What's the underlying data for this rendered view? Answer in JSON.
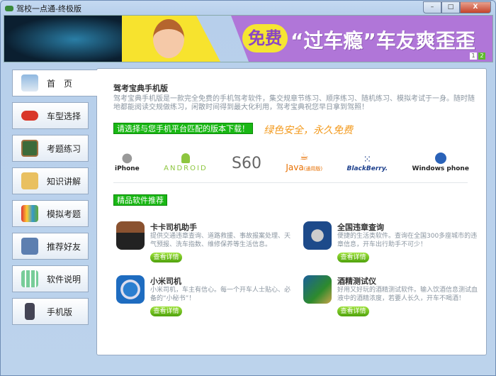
{
  "window": {
    "title": "驾校一点通-终极版",
    "minimize": "–",
    "maximize": "□",
    "close": "X"
  },
  "banner": {
    "badge": "免费",
    "headline": "“过车瘾”车友爽歪歪",
    "pages": [
      "1",
      "2"
    ]
  },
  "sidebar": {
    "items": [
      {
        "label": "首　页"
      },
      {
        "label": "车型选择"
      },
      {
        "label": "考题练习"
      },
      {
        "label": "知识讲解"
      },
      {
        "label": "模拟考题"
      },
      {
        "label": "推荐好友"
      },
      {
        "label": "软件说明"
      },
      {
        "label": "手机版"
      }
    ]
  },
  "main": {
    "title": "驾考宝典手机版",
    "description": "驾考宝典手机版是一款完全免费的手机驾考软件，集交规章节练习、顺序练习、随机练习、模拟考试于一身。随时随地都能阅读交规做练习，闲散时间得到最大化利用，驾考宝典祝您早日拿到驾照！",
    "download_banner": "请选择与您手机平台匹配的版本下载！",
    "slogan": "绿色安全，永久免费",
    "platforms": [
      {
        "name": "iPhone",
        "icon": "apple-icon"
      },
      {
        "name": "ANDROID",
        "icon": "android-icon"
      },
      {
        "name": "S60",
        "icon": "s60-icon"
      },
      {
        "name": "Java",
        "sub": "(通用版)",
        "icon": "java-icon"
      },
      {
        "name": "BlackBerry.",
        "icon": "blackberry-icon"
      },
      {
        "name": "Windows phone",
        "icon": "windows-icon"
      }
    ],
    "recommend_title": "精品软件推荐",
    "apps": [
      {
        "name": "卡卡司机助手",
        "desc": "提供交通违章查询、道路救援、事故报案处理、天气预报、洗车指数、维修保养等生活信息。",
        "button": "查看详情"
      },
      {
        "name": "全国违章查询",
        "desc": "便捷的生活类软件。查询在全国300多座城市的违章信息，开车出行助手不可少！",
        "button": "查看详情"
      },
      {
        "name": "小米司机",
        "desc": "小米司机，车主有信心。每一个开车人士贴心、必备的“小秘书”！",
        "button": "查看详情"
      },
      {
        "name": "酒精测试仪",
        "desc": "好用又好玩的酒精测试软件。输入饮酒信息测试血液中的酒精浓度，若要人长久，开车不喝酒！",
        "button": "查看详情"
      }
    ]
  },
  "colors": {
    "accent_green": "#19b714",
    "slogan_orange": "#f39a1e",
    "banner_purple": "#b076d8"
  }
}
